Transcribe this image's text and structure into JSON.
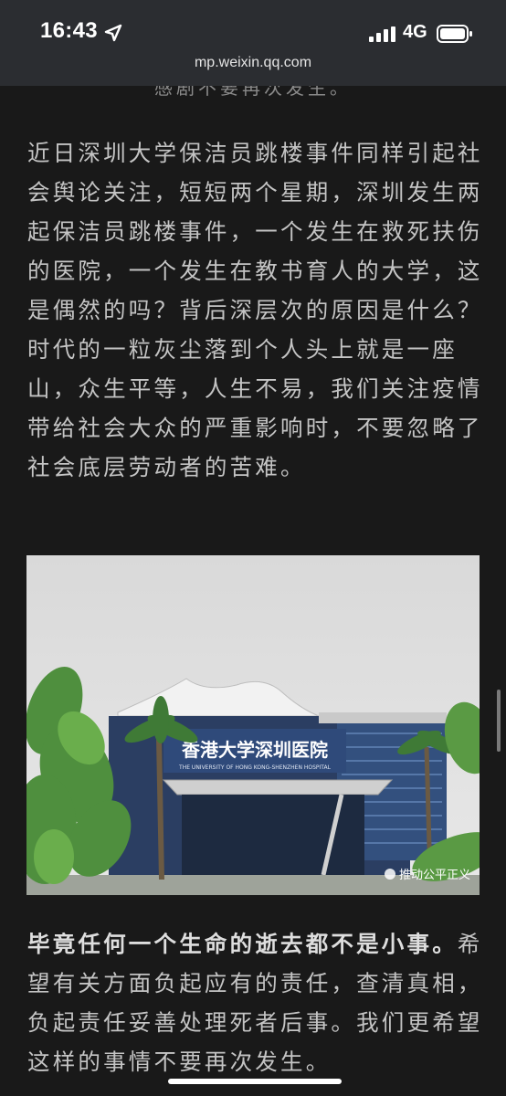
{
  "status": {
    "time": "16:43",
    "network": "4G",
    "url": "mp.weixin.qq.com"
  },
  "article": {
    "cut_off_line": "感剧不要再次发生。",
    "paragraph1": "近日深圳大学保洁员跳楼事件同样引起社会舆论关注，短短两个星期，深圳发生两起保洁员跳楼事件，一个发生在救死扶伤的医院，一个发生在教书育人的大学，这是偶然的吗？背后深层次的原因是什么？时代的一粒灰尘落到个人头上就是一座山，众生平等，人生不易，我们关注疫情带给社会大众的严重影响时，不要忽略了社会底层劳动者的苦难。",
    "photo": {
      "sign_cn": "香港大学深圳医院",
      "sign_en": "THE UNIVERSITY OF HONG KONG-SHENZHEN HOSPITAL",
      "watermark": "推动公平正义"
    },
    "paragraph2_bold": "毕竟任何一个生命的逝去都不是小事。",
    "paragraph2_rest": "希望有关方面负起应有的责任，查清真相，负起责任妥善处理死者后事。我们更希望这样的事情不要再次发生。"
  },
  "colors": {
    "background": "#191919",
    "status_bar": "#2b2d31",
    "text": "#c4c4c4"
  }
}
